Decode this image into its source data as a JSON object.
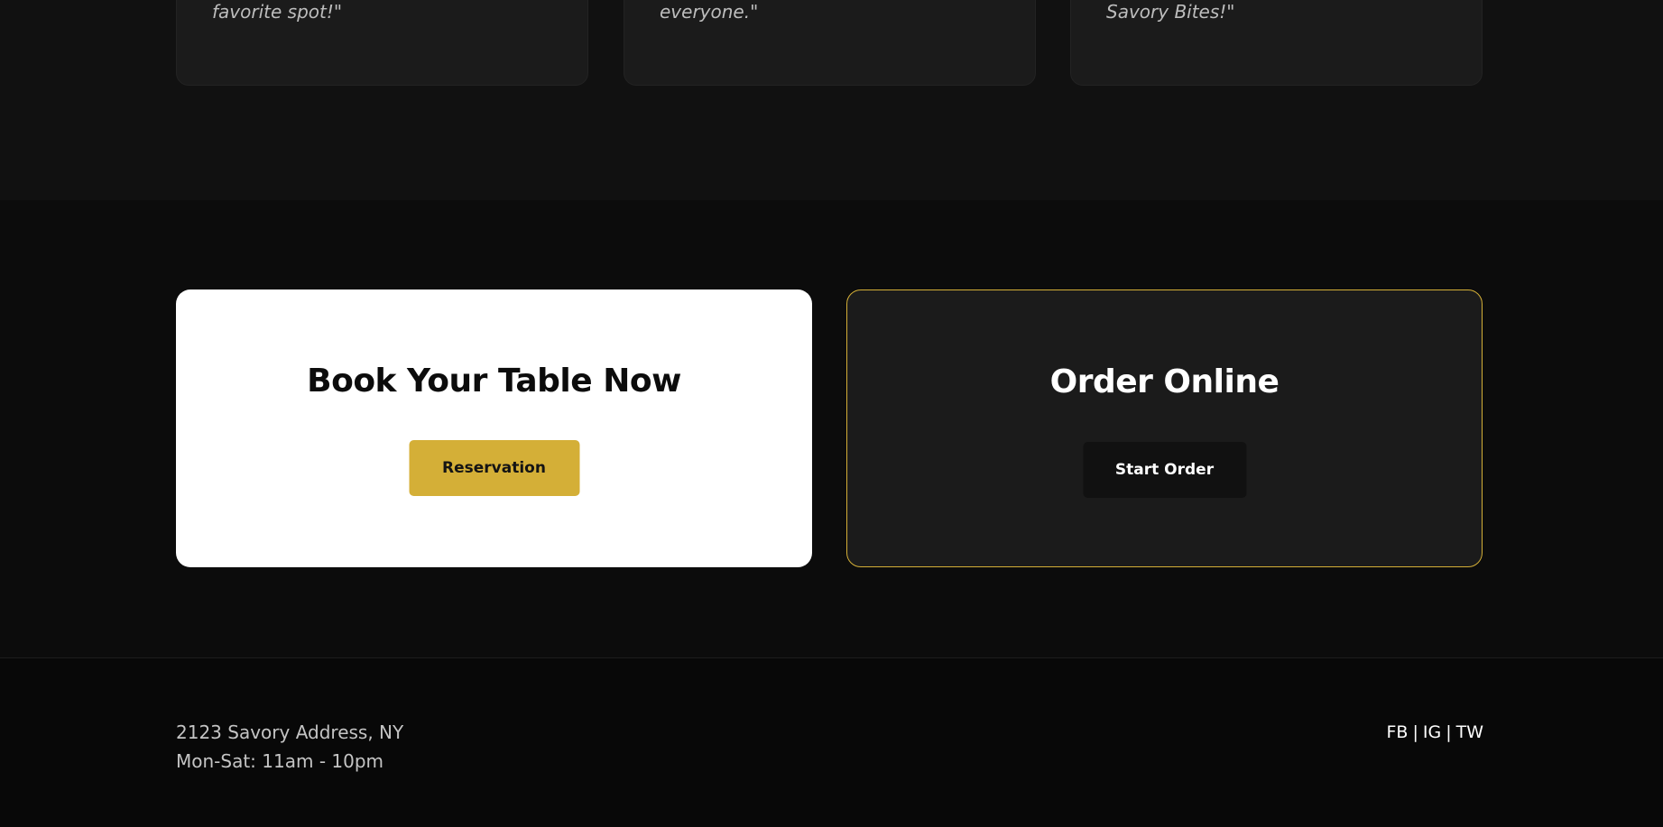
{
  "testimonials": {
    "cards": [
      {
        "quote_tail": "favorite spot!\""
      },
      {
        "quote_tail": "everyone.\""
      },
      {
        "quote_tail": "Savory Bites!\""
      }
    ]
  },
  "cta": {
    "book": {
      "title": "Book Your Table Now",
      "button_label": "Reservation"
    },
    "order": {
      "title": "Order Online",
      "button_label": "Start Order"
    }
  },
  "footer": {
    "address": "2123 Savory Address, NY",
    "hours": "Mon-Sat: 11am - 10pm",
    "social": {
      "facebook": "FB",
      "instagram": "IG",
      "twitter": "TW",
      "separator": "|"
    }
  },
  "colors": {
    "accent": "#d4af37",
    "background": "#0c0c0c",
    "card_dark": "#1b1b1b",
    "card_light": "#ffffff"
  }
}
